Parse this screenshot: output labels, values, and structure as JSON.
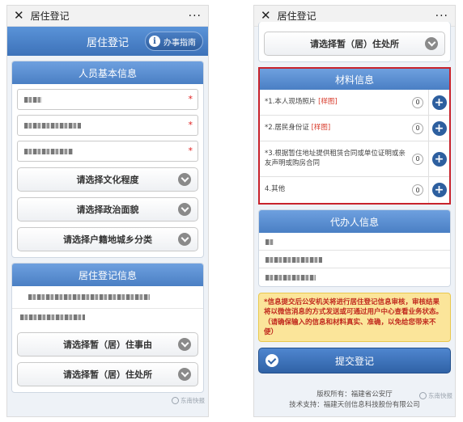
{
  "left": {
    "topbar": {
      "close_glyph": "✕",
      "title": "居住登记",
      "more_glyph": "···"
    },
    "header": {
      "title": "居住登记",
      "guide_label": "办事指南",
      "guide_icon_glyph": "i"
    },
    "basic_info": {
      "title": "人员基本信息",
      "required_mark": "*",
      "select_education": "请选择文化程度",
      "select_political": "请选择政治面貌",
      "select_household": "请选择户籍地城乡分类"
    },
    "residence_info": {
      "title": "居住登记信息",
      "select_reason": "请选择暂（居）住事由",
      "select_place": "请选择暂（居）住处所"
    },
    "watermark": "东南快报"
  },
  "right": {
    "topbar": {
      "close_glyph": "✕",
      "title": "居住登记",
      "more_glyph": "···"
    },
    "top_select": "请选择暂（居）住处所",
    "materials": {
      "title": "材料信息",
      "sample_label": "[样图]",
      "plus_glyph": "+",
      "items": [
        {
          "label": "*1.本人现场照片",
          "count": "0"
        },
        {
          "label": "*2.居民身份证",
          "count": "0"
        },
        {
          "label": "*3.根据暂住地址提供租赁合同或单位证明或亲友声明或购房合同",
          "count": "0"
        },
        {
          "label": "4.其他",
          "count": "0"
        }
      ]
    },
    "agent_info": {
      "title": "代办人信息"
    },
    "notice": "*信息提交后公安机关将进行居住登记信息审核，审核结果将以微信消息的方式发送或可通过用户中心查看业务状态。（请确保输入的信息和材料真实、准确，以免给您带来不便）",
    "submit_label": "提交登记",
    "footer": {
      "copyright": "版权所有：福建省公安厅",
      "support": "技术支持：福建天创信息科技股份有限公司"
    },
    "watermark": "东南快报"
  }
}
